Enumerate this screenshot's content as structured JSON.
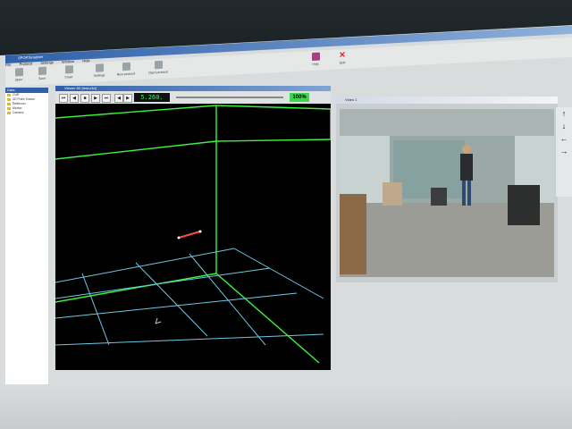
{
  "app": {
    "title": "SPORTanalyser",
    "menu": [
      "File",
      "Protocol",
      "Settings",
      "Window",
      "Help"
    ]
  },
  "toolbar": {
    "items": [
      "Open",
      "Save",
      "Close",
      "Settings",
      "New protocol",
      "Open protocol",
      "Help",
      "Quit"
    ]
  },
  "sidebar": {
    "header": "Data",
    "items": [
      "CUR",
      "3D Point Tracks",
      "Reflexion",
      "Motion",
      "Camera"
    ]
  },
  "viewer": {
    "title": "Viewer 3D [test.c3d]",
    "frame": "5.260.",
    "zoom": "100%"
  },
  "video": {
    "title": "Video 1"
  },
  "arrows": [
    "↑",
    "↓",
    "←",
    "→"
  ],
  "colors": {
    "grid_green": "#3cf23c",
    "grid_blue": "#6ec9e6",
    "marker": "#ff4a4a",
    "viewer_bg": "#000000"
  }
}
